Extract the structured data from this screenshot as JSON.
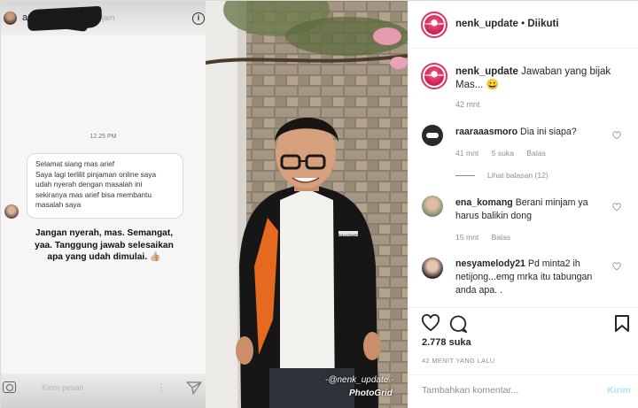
{
  "story": {
    "username": "ariefmuhammadd",
    "time": "jam",
    "chat_time": "12.25 PM",
    "message_lines": [
      "Selamat siang mas arief",
      "Saya lagi terlilit pinjaman online saya",
      "udah nyerah dengan masalah ini",
      "sekiranya mas arief bisa membantu",
      "masalah saya"
    ],
    "reply_lines": [
      "Jangan nyerah, mas. Semangat,",
      "yaa. Tanggung jawab selesaikan",
      "apa yang udah dimulai. 👍🏼"
    ],
    "message_placeholder": "Kirim pesan"
  },
  "photo": {
    "watermark_user": "-@nenk_update -",
    "watermark_app": "PhotoGrid",
    "name_tag": "BILLIONAIRE'S"
  },
  "post": {
    "header": {
      "username": "nenk_update",
      "separator": "•",
      "follow_status": "Diikuti",
      "avatar_text": "nenk_update"
    },
    "caption": {
      "username": "nenk_update",
      "text": "Jawaban yang bijak Mas... 😀",
      "time": "42 mnt"
    },
    "comments": [
      {
        "username": "raaraaasmoro",
        "text": "Dia ini siapa?",
        "time": "41 mnt",
        "likes": "5 suka",
        "reply": "Balas",
        "view_replies": "Lihat balasan (12)"
      },
      {
        "username": "ena_komang",
        "text": "Berani minjam ya harus balikin dong",
        "time": "15 mnt",
        "reply": "Balas"
      },
      {
        "username": "nesyamelody21",
        "text": "Pd minta2 ih netijong...emg mrka itu tabungan anda apa. ."
      }
    ],
    "likes": "2.778 suka",
    "time_ago": "42 MENIT YANG LALU",
    "comment_placeholder": "Tambahkan komentar...",
    "post_button": "Kirim"
  },
  "colors": {
    "brand_pink": "#e1306c",
    "link_blue": "#b2dffc",
    "muted": "#8e8e8e"
  }
}
